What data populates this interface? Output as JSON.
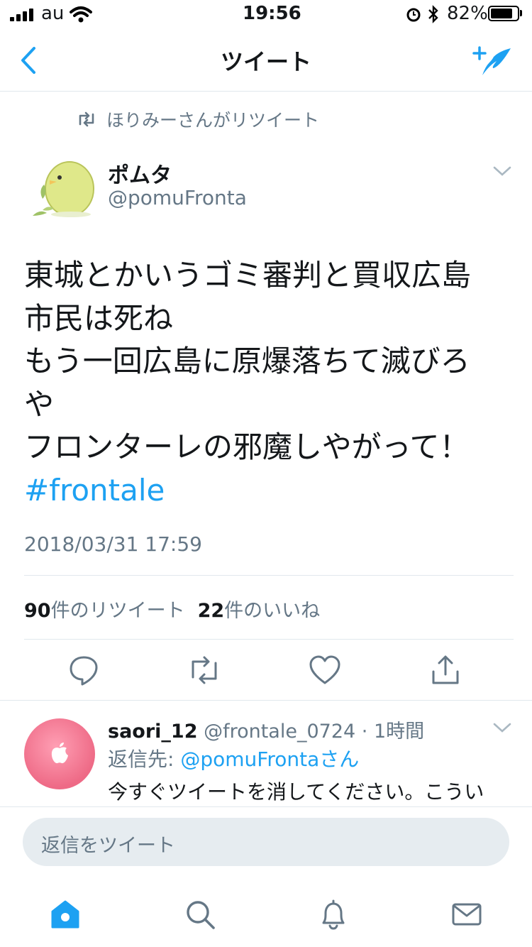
{
  "status_bar": {
    "carrier": "au",
    "time": "19:56",
    "battery_percent": "82%",
    "battery_level": 0.82
  },
  "nav": {
    "title": "ツイート",
    "back_icon": "chevron-left-icon",
    "compose_icon": "compose-tweet-icon"
  },
  "tweet": {
    "retweeted_by": "ほりみーさんがリツイート",
    "author_name": "ポムタ",
    "author_handle": "@pomuFronta",
    "body_lines": [
      "東城とかいうゴミ審判と買収広島",
      "市民は死ね",
      "もう一回広島に原爆落ちて滅びろ",
      "や",
      "フロンターレの邪魔しやがって！"
    ],
    "hashtag": "#frontale",
    "timestamp": "2018/03/31 17:59",
    "retweet_count": "90",
    "retweet_label": "件のリツイート",
    "like_count": "22",
    "like_label": "件のいいね"
  },
  "reply": {
    "name": "saori_12",
    "handle": "@frontale_0724",
    "time_ago": "· 1時間",
    "reply_to_prefix": "返信先: ",
    "reply_to_mention": "@pomuFrontaさん",
    "text": "今すぐツイートを消してください。こうい"
  },
  "composer": {
    "placeholder": "返信をツイート"
  },
  "colors": {
    "accent": "#1da1f2",
    "secondary_text": "#657786",
    "divider": "#e1e8ed"
  }
}
